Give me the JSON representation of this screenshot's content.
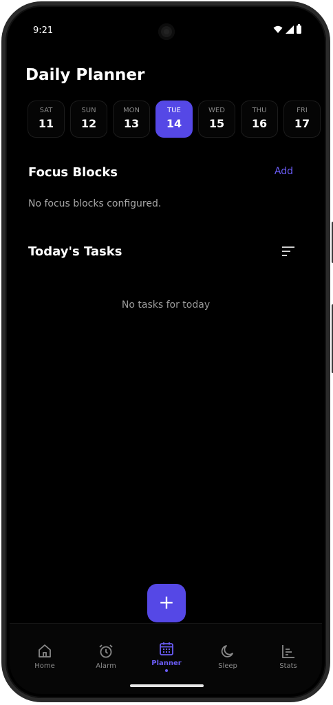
{
  "status_bar": {
    "time": "9:21"
  },
  "header": {
    "title": "Daily Planner"
  },
  "days": [
    {
      "name": "SAT",
      "num": "11"
    },
    {
      "name": "SUN",
      "num": "12"
    },
    {
      "name": "MON",
      "num": "13"
    },
    {
      "name": "TUE",
      "num": "14"
    },
    {
      "name": "WED",
      "num": "15"
    },
    {
      "name": "THU",
      "num": "16"
    },
    {
      "name": "FRI",
      "num": "17"
    }
  ],
  "focus": {
    "title": "Focus Blocks",
    "add_label": "Add",
    "empty": "No focus blocks configured."
  },
  "tasks": {
    "title": "Today's Tasks",
    "empty": "No tasks for today"
  },
  "fab": {
    "label": "+"
  },
  "nav": {
    "items": [
      {
        "label": "Home"
      },
      {
        "label": "Alarm"
      },
      {
        "label": "Planner"
      },
      {
        "label": "Sleep"
      },
      {
        "label": "Stats"
      }
    ]
  },
  "colors": {
    "accent": "#5548e6",
    "accent_text": "#6a5cf5",
    "background": "#000000"
  },
  "icons": [
    "wifi-icon",
    "signal-icon",
    "battery-icon",
    "sort-icon",
    "plus-icon",
    "home-icon",
    "alarm-icon",
    "calendar-icon",
    "moon-icon",
    "bar-chart-icon"
  ]
}
